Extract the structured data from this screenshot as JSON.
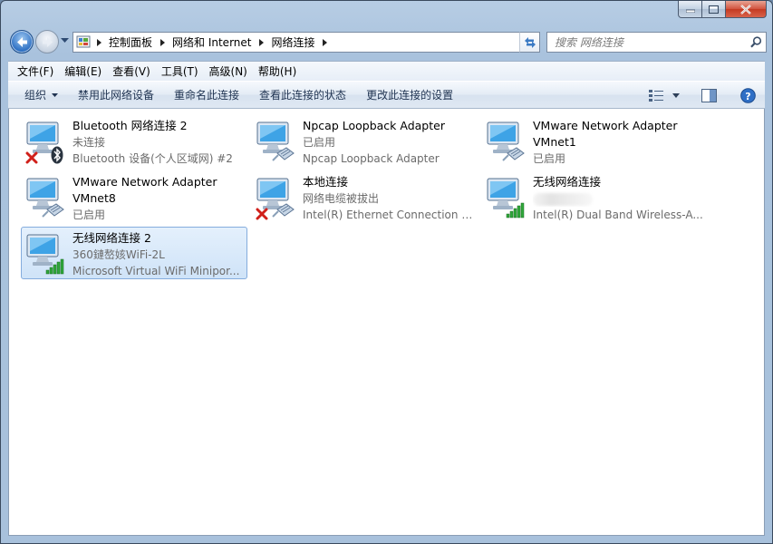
{
  "window": {
    "colors": {
      "accent": "#2b6ec2",
      "selection": "#cfe3f8",
      "status_text": "#6b6b6b",
      "error_red": "#d0201a",
      "signal_green": "#2fa83a"
    }
  },
  "address": {
    "segments": [
      "控制面板",
      "网络和 Internet",
      "网络连接"
    ],
    "search_placeholder": "搜索 网络连接"
  },
  "menu": {
    "items": [
      "文件(F)",
      "编辑(E)",
      "查看(V)",
      "工具(T)",
      "高级(N)",
      "帮助(H)"
    ]
  },
  "toolbar": {
    "organize": "组织",
    "disable": "禁用此网络设备",
    "rename": "重命名此连接",
    "view_status": "查看此连接的状态",
    "change_settings": "更改此连接的设置",
    "icons": [
      "view-options-icon",
      "preview-pane-icon",
      "help-icon"
    ]
  },
  "connections": [
    {
      "name": "Bluetooth 网络连接 2",
      "status": "未连接",
      "device": "Bluetooth 设备(个人区域网) #2",
      "icon": "bluetooth-icon",
      "badge": "disconnected-x-icon"
    },
    {
      "name": "Npcap Loopback Adapter",
      "status": "已启用",
      "device": "Npcap Loopback Adapter",
      "icon": "ethernet-cable-icon",
      "badge": ""
    },
    {
      "name": "VMware Network Adapter",
      "status": "VMnet1",
      "device": "已启用",
      "icon": "ethernet-cable-icon",
      "badge": ""
    },
    {
      "name": "VMware Network Adapter",
      "status": "VMnet8",
      "device": "已启用",
      "icon": "ethernet-cable-icon",
      "badge": ""
    },
    {
      "name": "本地连接",
      "status": "网络电缆被拔出",
      "device": "Intel(R) Ethernet Connection (3...",
      "icon": "ethernet-cable-icon",
      "badge": "disconnected-x-icon"
    },
    {
      "name": "无线网络连接",
      "status": "",
      "device": "Intel(R) Dual Band Wireless-A...",
      "icon": "wifi-signal-icon",
      "badge": ""
    },
    {
      "name": "无线网络连接 2",
      "status": "360鏈嶅姟WiFi-2L",
      "device": "Microsoft Virtual WiFi Minipor...",
      "icon": "wifi-signal-icon",
      "badge": "",
      "selected": true
    }
  ]
}
